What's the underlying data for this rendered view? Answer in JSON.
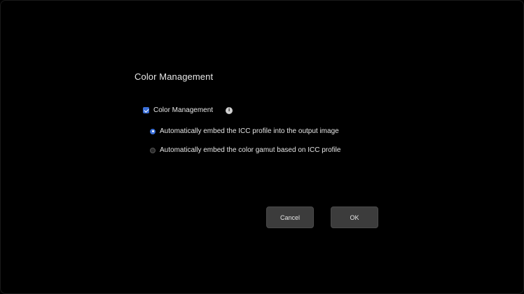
{
  "dialog": {
    "title": "Color Management"
  },
  "main_checkbox": {
    "label": "Color Management",
    "checked": true,
    "info_icon": "info-icon"
  },
  "options": [
    {
      "label": "Automatically embed the ICC profile into the output image",
      "selected": true
    },
    {
      "label": "Automatically embed the color gamut based on ICC profile",
      "selected": false
    }
  ],
  "buttons": {
    "cancel_label": "Cancel",
    "ok_label": "OK"
  },
  "colors": {
    "background": "#000000",
    "accent": "#3a6fd8",
    "button_bg": "#3c3c3c",
    "text": "#e6e6e6"
  }
}
